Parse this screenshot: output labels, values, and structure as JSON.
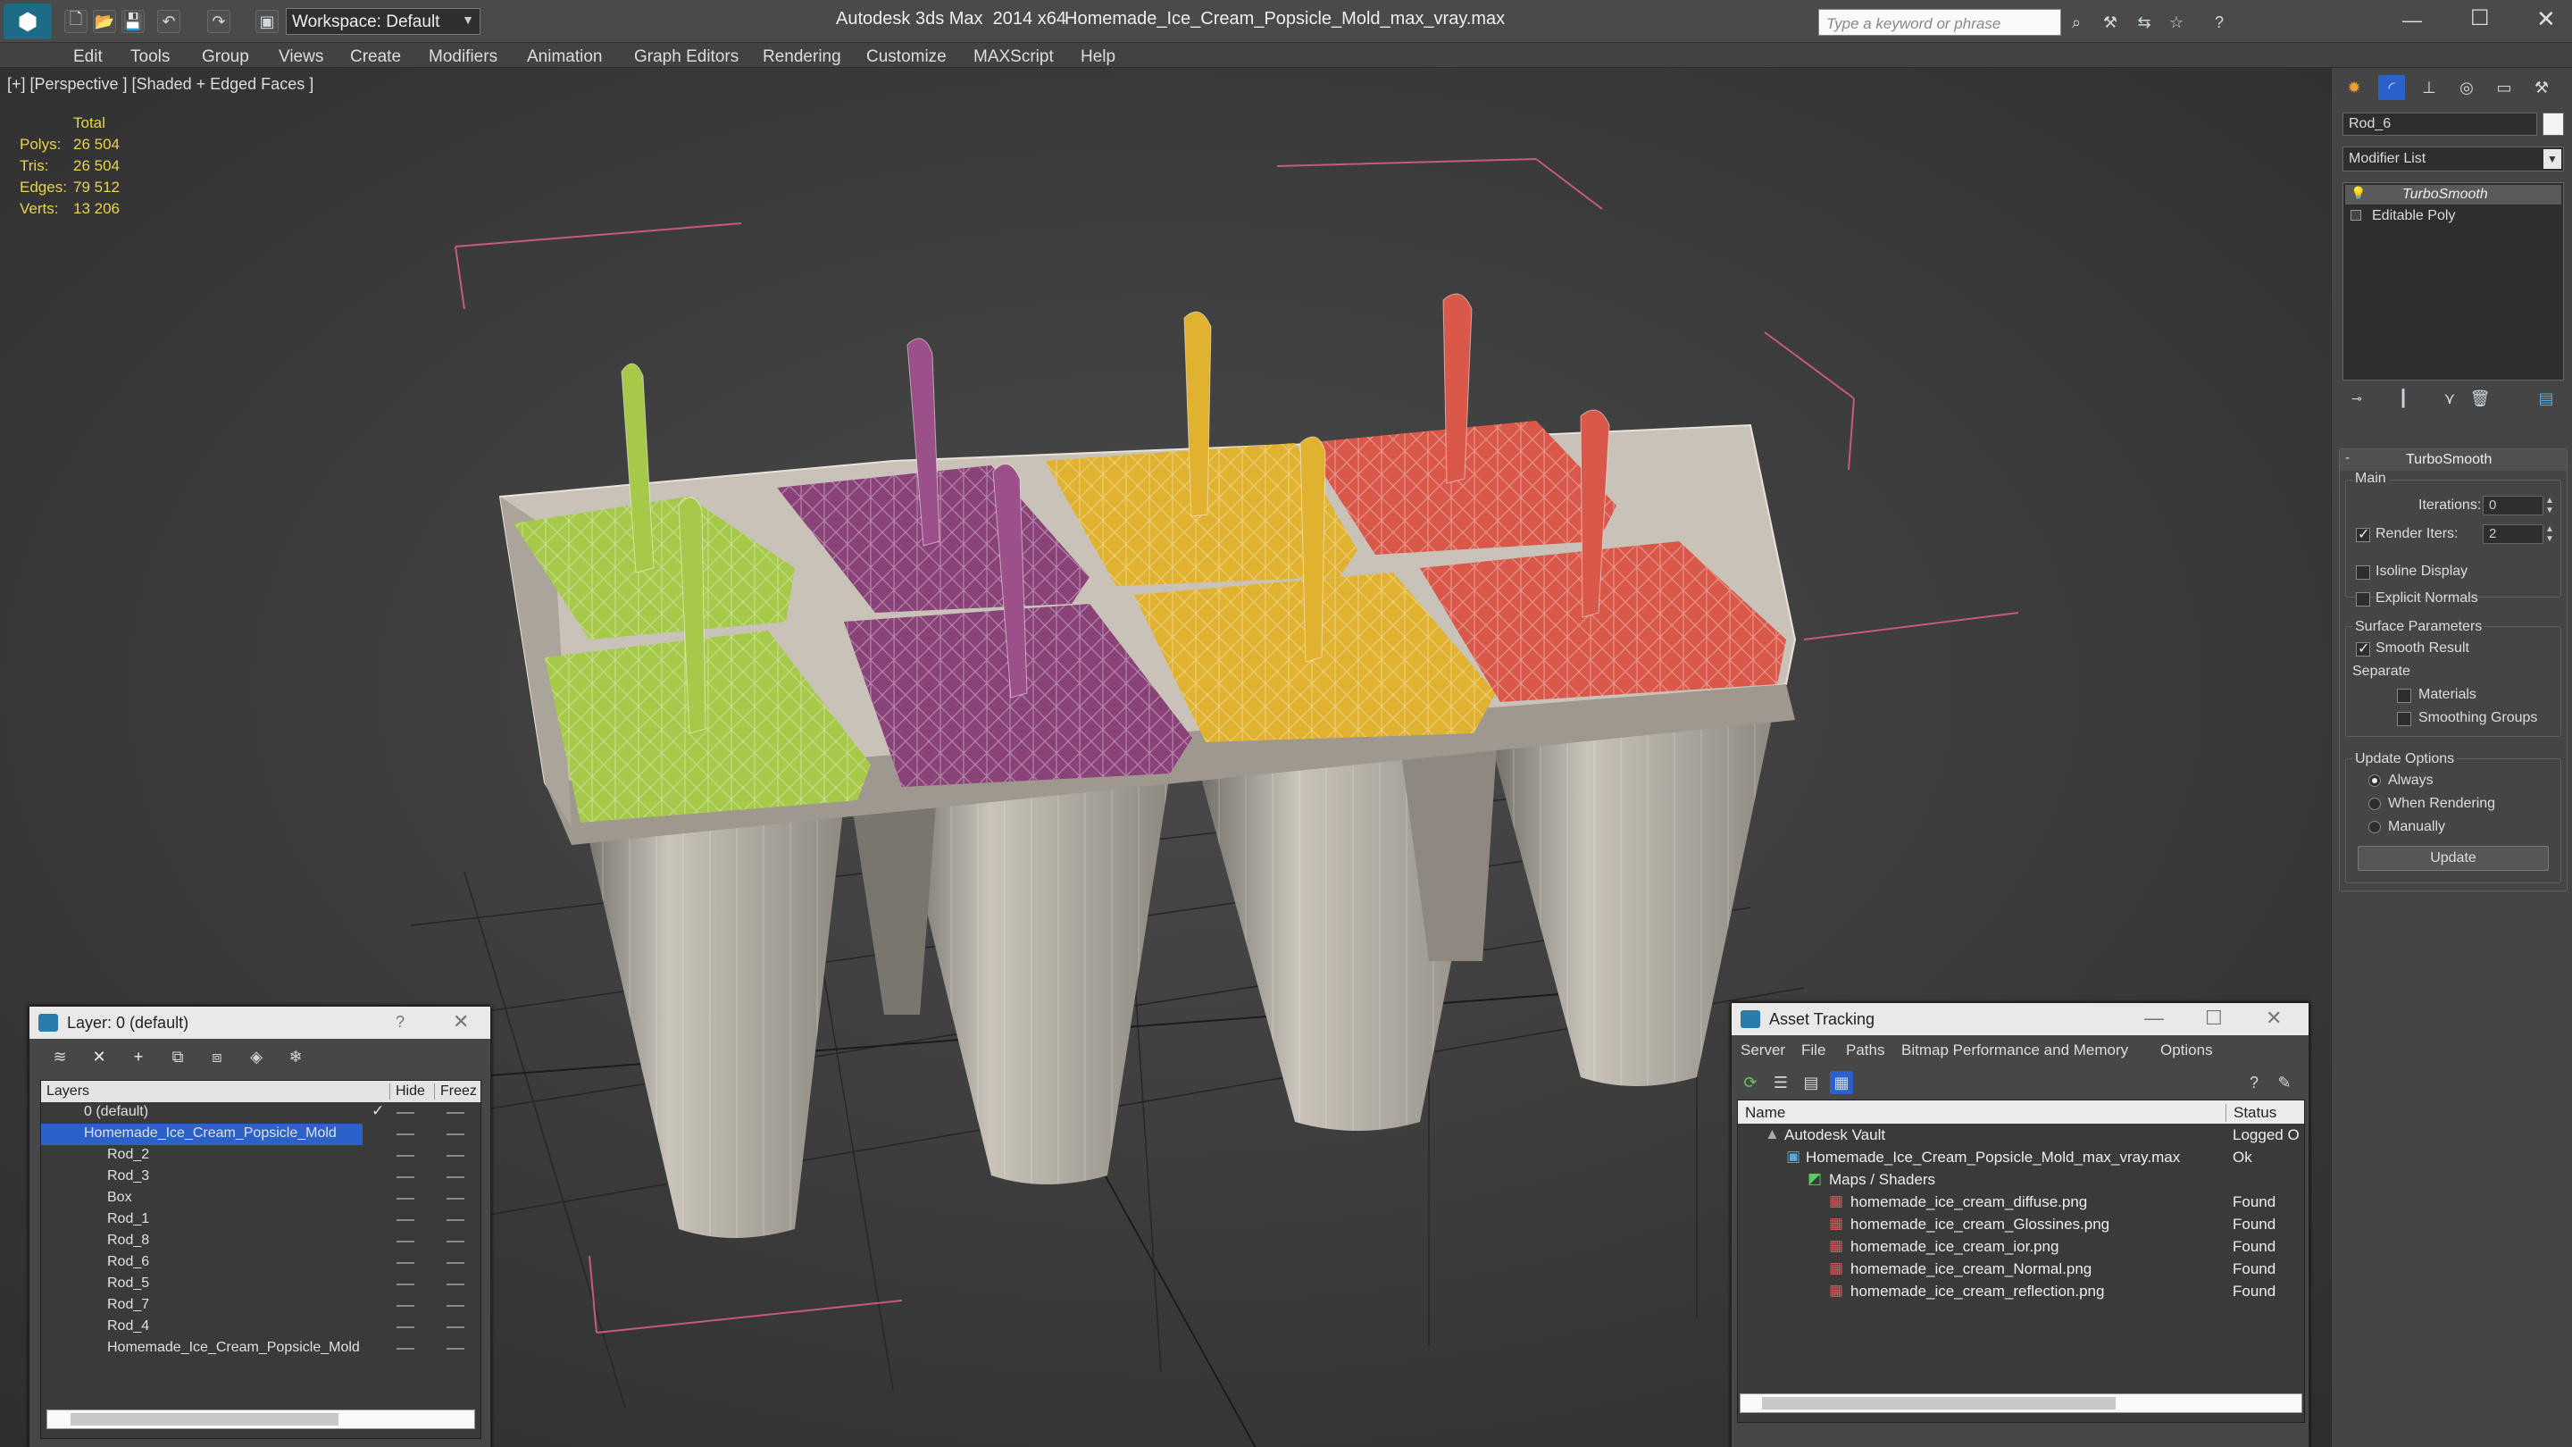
{
  "titlebar": {
    "workspace": "Workspace: Default",
    "app_title": "Autodesk 3ds Max  2014 x64",
    "file_name": "Homemade_Ice_Cream_Popsicle_Mold_max_vray.max",
    "search_placeholder": "Type a keyword or phrase"
  },
  "menu": [
    "Edit",
    "Tools",
    "Group",
    "Views",
    "Create",
    "Modifiers",
    "Animation",
    "Graph Editors",
    "Rendering",
    "Customize",
    "MAXScript",
    "Help"
  ],
  "viewport": {
    "label": "[+] [Perspective ] [Shaded + Edged Faces ]",
    "stats": {
      "header": "Total",
      "rows": [
        {
          "label": "Polys:",
          "value": "26 504"
        },
        {
          "label": "Tris:",
          "value": "26 504"
        },
        {
          "label": "Edges:",
          "value": "79 512"
        },
        {
          "label": "Verts:",
          "value": "13 206"
        }
      ]
    }
  },
  "command_panel": {
    "object_name": "Rod_6",
    "modifier_list": "Modifier List",
    "stack": [
      "TurboSmooth",
      "Editable Poly"
    ],
    "rollout_title": "TurboSmooth",
    "main_group": "Main",
    "iterations_label": "Iterations:",
    "iterations_value": "0",
    "render_iters_label": "Render Iters:",
    "render_iters_value": "2",
    "isoline_display": "Isoline Display",
    "explicit_normals": "Explicit Normals",
    "surface_params": "Surface Parameters",
    "smooth_result": "Smooth Result",
    "separate": "Separate",
    "materials": "Materials",
    "smoothing_groups": "Smoothing Groups",
    "update_options": "Update Options",
    "always": "Always",
    "when_rendering": "When Rendering",
    "manually": "Manually",
    "update_button": "Update"
  },
  "layer_window": {
    "title": "Layer: 0 (default)",
    "help": "?",
    "columns": {
      "layers": "Layers",
      "hide": "Hide",
      "freeze": "Freez"
    },
    "rows": [
      {
        "name": "0 (default)"
      },
      {
        "name": "Homemade_Ice_Cream_Popsicle_Mold"
      },
      {
        "name": "Rod_2"
      },
      {
        "name": "Rod_3"
      },
      {
        "name": "Box"
      },
      {
        "name": "Rod_1"
      },
      {
        "name": "Rod_8"
      },
      {
        "name": "Rod_6"
      },
      {
        "name": "Rod_5"
      },
      {
        "name": "Rod_7"
      },
      {
        "name": "Rod_4"
      },
      {
        "name": "Homemade_Ice_Cream_Popsicle_Mold"
      }
    ]
  },
  "asset_window": {
    "title": "Asset Tracking",
    "menu": [
      "Server",
      "File",
      "Paths",
      "Bitmap Performance and Memory",
      "Options"
    ],
    "columns": {
      "name": "Name",
      "status": "Status"
    },
    "rows": [
      {
        "name": "Autodesk Vault",
        "status": "Logged O"
      },
      {
        "name": "Homemade_Ice_Cream_Popsicle_Mold_max_vray.max",
        "status": "Ok"
      },
      {
        "name": "Maps / Shaders",
        "status": ""
      },
      {
        "name": "homemade_ice_cream_diffuse.png",
        "status": "Found"
      },
      {
        "name": "homemade_ice_cream_Glossines.png",
        "status": "Found"
      },
      {
        "name": "homemade_ice_cream_ior.png",
        "status": "Found"
      },
      {
        "name": "homemade_ice_cream_Normal.png",
        "status": "Found"
      },
      {
        "name": "homemade_ice_cream_reflection.png",
        "status": "Found"
      }
    ]
  },
  "colors": {
    "lime": "#a6c94a",
    "purple": "#8a4378",
    "yellow": "#e0b230",
    "coral": "#d9584a",
    "selection": "#2a62c9",
    "stats_text": "#e8d34a"
  }
}
